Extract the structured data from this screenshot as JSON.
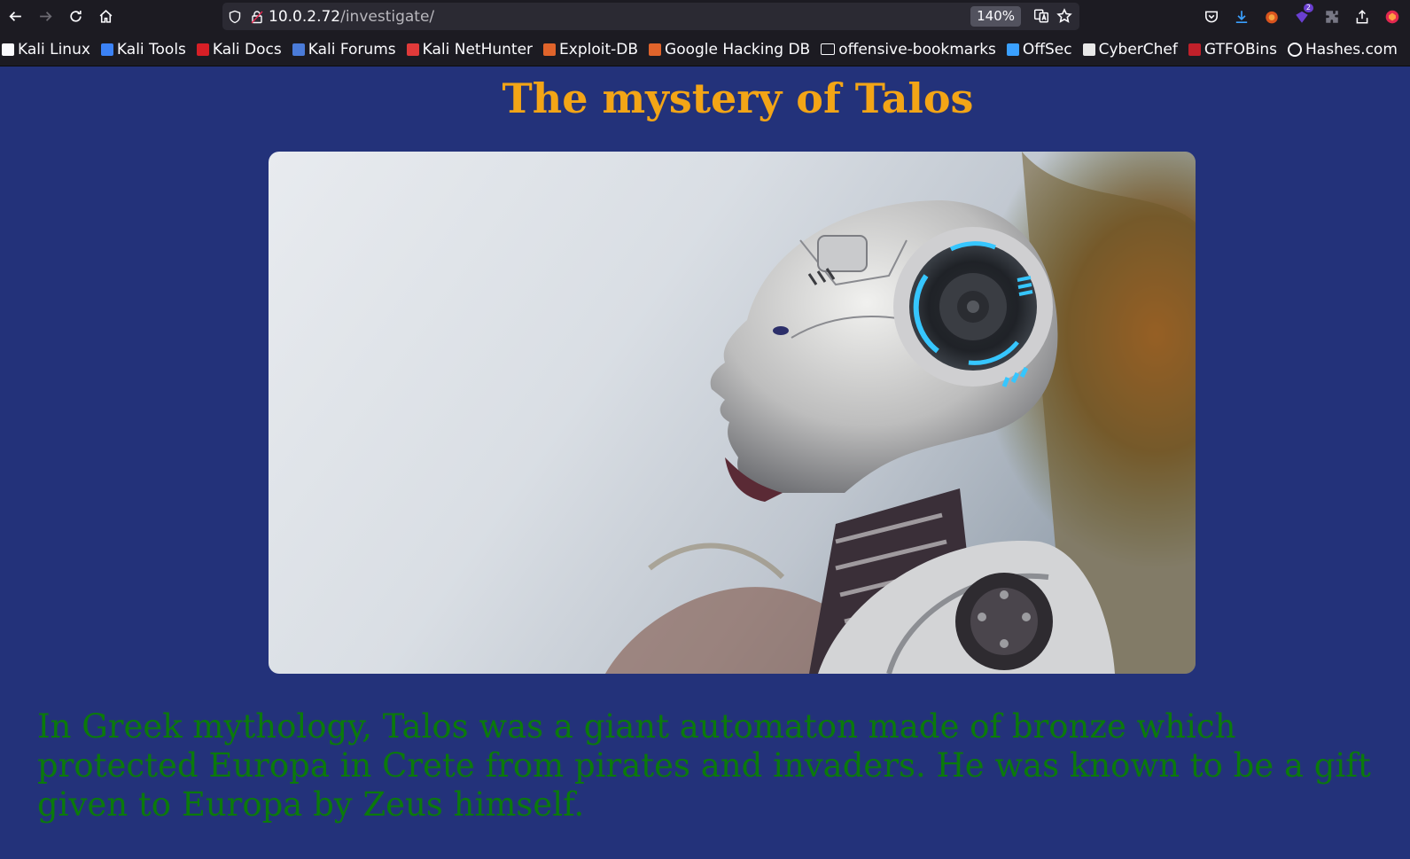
{
  "browser": {
    "url_host": "10.0.2.72",
    "url_path": "/investigate/",
    "zoom": "140%",
    "extension_badge": "2"
  },
  "bookmarks": [
    {
      "label": "Kali Linux",
      "icon": "kali-dragon-icon",
      "color": "#fbfbfe"
    },
    {
      "label": "Kali Tools",
      "icon": "kali-tools-icon",
      "color": "#3b82f6"
    },
    {
      "label": "Kali Docs",
      "icon": "kali-docs-icon",
      "color": "#d71f26"
    },
    {
      "label": "Kali Forums",
      "icon": "kali-forums-icon",
      "color": "#4a7bd9"
    },
    {
      "label": "Kali NetHunter",
      "icon": "nethunter-icon",
      "color": "#e03a3a"
    },
    {
      "label": "Exploit-DB",
      "icon": "exploit-db-icon",
      "color": "#e0642b"
    },
    {
      "label": "Google Hacking DB",
      "icon": "ghdb-icon",
      "color": "#e0642b"
    },
    {
      "label": "offensive-bookmarks",
      "icon": "folder-icon",
      "color": "#fbfbfe"
    },
    {
      "label": "OffSec",
      "icon": "offsec-icon",
      "color": "#3aa0ff"
    },
    {
      "label": "CyberChef",
      "icon": "cyberchef-icon",
      "color": "#e8e8e8"
    },
    {
      "label": "GTFOBins",
      "icon": "gtfobins-icon",
      "color": "#c0202a"
    },
    {
      "label": "Hashes.com",
      "icon": "hashes-icon",
      "color": "#fbfbfe"
    }
  ],
  "page": {
    "title": "The mystery of Talos",
    "intro": "In Greek mythology, Talos was a giant automaton made of bronze which protected Europa in Crete from pirates and invaders. He was known to be a gift given to Europa by Zeus himself.",
    "colors": {
      "background": "#23327a",
      "title": "#f3a516",
      "text": "#0b7a0b"
    }
  }
}
